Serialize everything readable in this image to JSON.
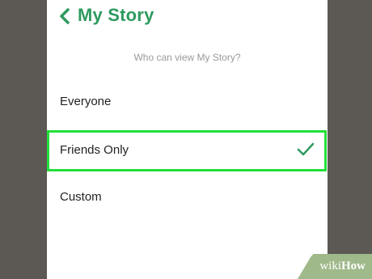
{
  "header": {
    "back_icon": "chevron-left-icon",
    "title": "My Story"
  },
  "prompt": "Who can view My Story?",
  "options": [
    {
      "label": "Everyone",
      "selected": false
    },
    {
      "label": "Friends Only",
      "selected": true,
      "indicator_icon": "checkmark-icon"
    },
    {
      "label": "Custom",
      "selected": false
    }
  ],
  "watermark": {
    "wiki": "wiki",
    "how": "How"
  },
  "colors": {
    "accent": "#2e9b5f",
    "highlight_border": "#22e03a",
    "background": "#5c5853"
  }
}
